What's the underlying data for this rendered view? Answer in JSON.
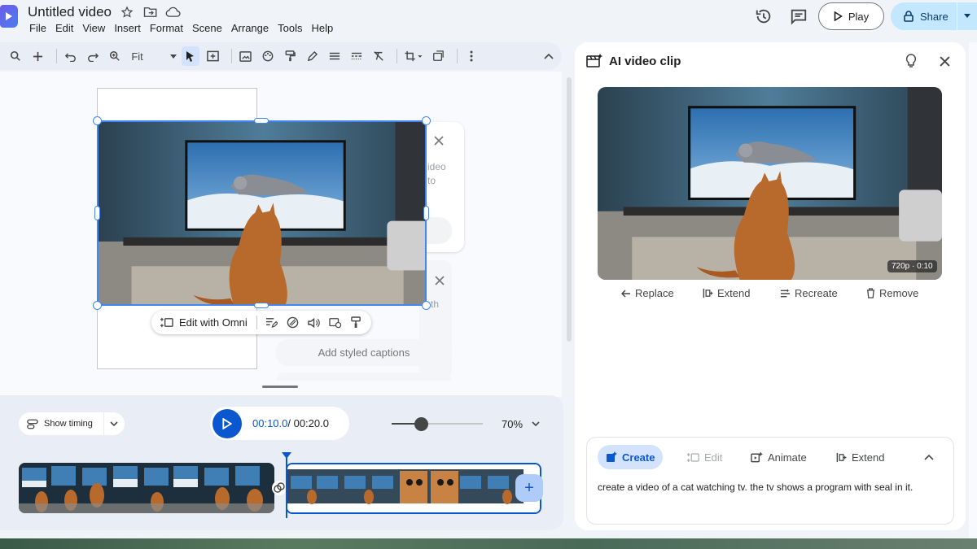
{
  "header": {
    "doc_title": "Untitled video",
    "menu": [
      "File",
      "Edit",
      "View",
      "Insert",
      "Format",
      "Scene",
      "Arrange",
      "Tools",
      "Help"
    ],
    "play_label": "Play",
    "share_label": "Share"
  },
  "toolbar": {
    "zoom_value": "Fit"
  },
  "canvas": {
    "float_toolbar": {
      "edit_omni_label": "Edit with Omni"
    },
    "ghost_card_text": [
      "ideo",
      "to",
      "th"
    ],
    "styled_captions_label": "Add styled captions"
  },
  "timeline": {
    "show_timing_label": "Show timing",
    "time_current": "00:10.0",
    "time_total": "/ 00:20.0",
    "zoom_percent": "70%",
    "zoom_level": 0.33
  },
  "side_panel": {
    "title": "AI video clip",
    "resolution_badge": "720p · 0:10",
    "actions": [
      "Replace",
      "Extend",
      "Recreate",
      "Remove"
    ],
    "tabs": [
      "Create",
      "Edit",
      "Animate",
      "Extend"
    ],
    "prompt": "create a video of a cat watching tv. the tv shows a program with seal in it."
  },
  "colors": {
    "accent": "#0b57d0",
    "selection": "#4285f4",
    "share_bg": "#c2e7ff",
    "panel_bg": "#f0f4f9"
  }
}
